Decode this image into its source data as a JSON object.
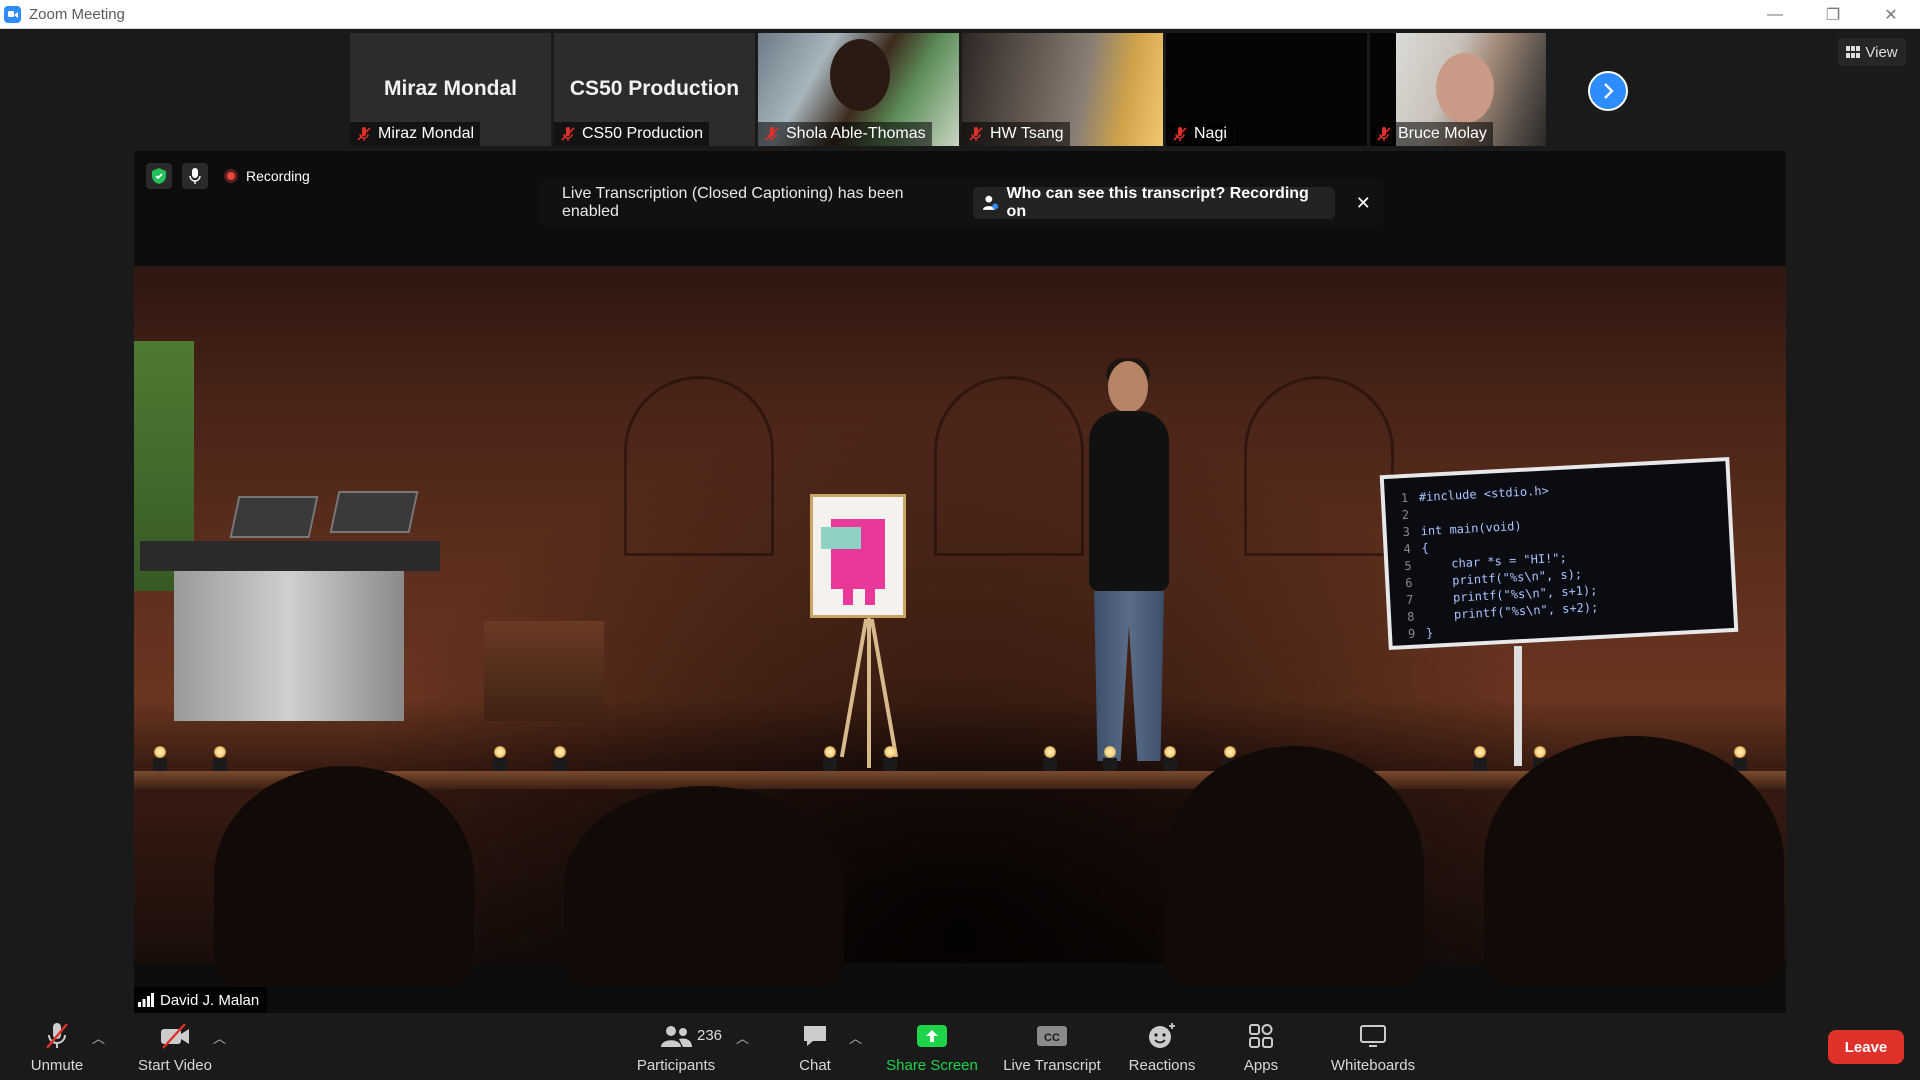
{
  "window": {
    "title": "Zoom Meeting",
    "controls": {
      "minimize": "—",
      "restore": "❐",
      "close": "✕"
    }
  },
  "gallery": {
    "tiles": [
      {
        "big_name": "Miraz Mondal",
        "label": "Miraz Mondal"
      },
      {
        "big_name": "CS50 Production",
        "label": "CS50 Production"
      },
      {
        "label": "Shola Able-Thomas"
      },
      {
        "label": "HW Tsang"
      },
      {
        "label": "Nagi"
      },
      {
        "label": "Bruce Molay"
      }
    ],
    "view_label": "View"
  },
  "main": {
    "recording_label": "Recording",
    "banner": {
      "message": "Live Transcription (Closed Captioning) has been enabled",
      "who_label": "Who can see this transcript? Recording on"
    },
    "speaker_name": "David J. Malan",
    "code_lines": [
      {
        "n": "1",
        "code": "#include <stdio.h>"
      },
      {
        "n": "2",
        "code": ""
      },
      {
        "n": "3",
        "code": "int main(void)"
      },
      {
        "n": "4",
        "code": "{"
      },
      {
        "n": "5",
        "code": "    char *s = \"HI!\";"
      },
      {
        "n": "6",
        "code": "    printf(\"%s\\n\", s);"
      },
      {
        "n": "7",
        "code": "    printf(\"%s\\n\", s+1);"
      },
      {
        "n": "8",
        "code": "    printf(\"%s\\n\", s+2);"
      },
      {
        "n": "9",
        "code": "}"
      }
    ]
  },
  "toolbar": {
    "unmute": "Unmute",
    "start_video": "Start Video",
    "participants": "Participants",
    "participant_count": "236",
    "chat": "Chat",
    "share_screen": "Share Screen",
    "live_transcript": "Live Transcript",
    "reactions": "Reactions",
    "apps": "Apps",
    "whiteboards": "Whiteboards",
    "leave": "Leave"
  },
  "colors": {
    "accent": "#2d8cff",
    "share_green": "#1fd34a",
    "leave_red": "#e0302a",
    "recording_red": "#e8463f"
  }
}
